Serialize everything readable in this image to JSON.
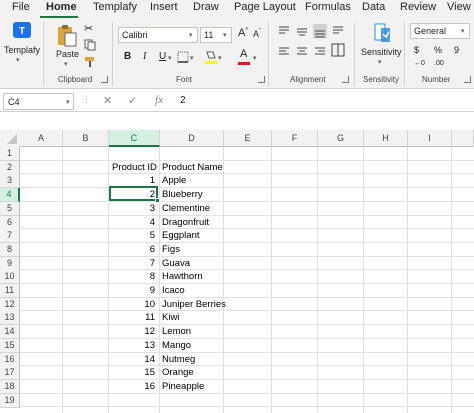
{
  "ribbon_tabs": [
    "File",
    "Home",
    "Templafy",
    "Insert",
    "Draw",
    "Page Layout",
    "Formulas",
    "Data",
    "Review",
    "View"
  ],
  "ribbon": {
    "templafy_label": "Templafy",
    "paste_label": "Paste",
    "clipboard_label": "Clipboard",
    "font_name": "Calibri",
    "font_size": "11",
    "font_label": "Font",
    "alignment_label": "Alignment",
    "sensitivity_button": "Sensitivity",
    "sensitivity_label": "Sensitivity",
    "number_format": "General",
    "number_label": "Number",
    "bold": "B",
    "italic": "I",
    "underline": "U",
    "font_color_glyph": "A"
  },
  "formula_bar": {
    "name_box": "C4",
    "cancel": "✕",
    "enter": "✓",
    "fx": "fx",
    "value": "2"
  },
  "columns": [
    "A",
    "B",
    "C",
    "D",
    "E",
    "F",
    "G",
    "H",
    "I"
  ],
  "rows": [
    "1",
    "2",
    "3",
    "4",
    "5",
    "6",
    "7",
    "8",
    "9",
    "10",
    "11",
    "12",
    "13",
    "14",
    "15",
    "16",
    "17",
    "18",
    "19"
  ],
  "headers": {
    "product_id": "Product ID",
    "product_name": "Product Name"
  },
  "products": [
    {
      "id": "1",
      "name": "Apple"
    },
    {
      "id": "2",
      "name": "Blueberry"
    },
    {
      "id": "3",
      "name": "Clementine"
    },
    {
      "id": "4",
      "name": "Dragonfruit"
    },
    {
      "id": "5",
      "name": "Eggplant"
    },
    {
      "id": "6",
      "name": "Figs"
    },
    {
      "id": "7",
      "name": "Guava"
    },
    {
      "id": "8",
      "name": "Hawthorn"
    },
    {
      "id": "9",
      "name": "Icaco"
    },
    {
      "id": "10",
      "name": "Juniper Berries"
    },
    {
      "id": "11",
      "name": "Kiwi"
    },
    {
      "id": "12",
      "name": "Lemon"
    },
    {
      "id": "13",
      "name": "Mango"
    },
    {
      "id": "14",
      "name": "Nutmeg"
    },
    {
      "id": "15",
      "name": "Orange"
    },
    {
      "id": "16",
      "name": "Pineapple"
    }
  ],
  "selected_cell": "C4",
  "colors": {
    "accent": "#217346",
    "templafy": "#1a73e8",
    "sensitivity": "#2b88d8",
    "font_color_bar": "#e81123"
  }
}
